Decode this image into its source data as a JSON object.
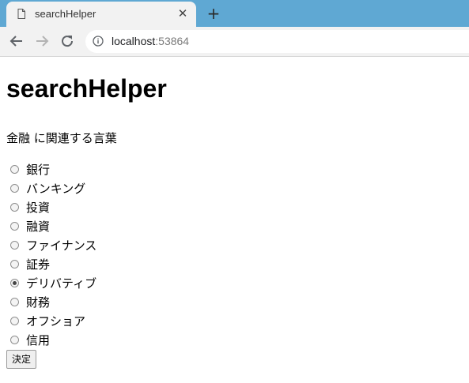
{
  "browser": {
    "tab_title": "searchHelper",
    "close_glyph": "✕",
    "new_tab_glyph": "+",
    "url_host": "localhost",
    "url_port": ":53864"
  },
  "page": {
    "heading": "searchHelper",
    "subtitle": "金融 に関連する言葉",
    "options": [
      {
        "label": "銀行",
        "checked": false
      },
      {
        "label": "バンキング",
        "checked": false
      },
      {
        "label": "投資",
        "checked": false
      },
      {
        "label": "融資",
        "checked": false
      },
      {
        "label": "ファイナンス",
        "checked": false
      },
      {
        "label": "証券",
        "checked": false
      },
      {
        "label": "デリバティブ",
        "checked": true
      },
      {
        "label": "財務",
        "checked": false
      },
      {
        "label": "オフショア",
        "checked": false
      },
      {
        "label": "信用",
        "checked": false
      }
    ],
    "submit_label": "決定"
  },
  "colors": {
    "tabstrip": "#5fa8d3",
    "toolbar": "#f2f2f2"
  }
}
